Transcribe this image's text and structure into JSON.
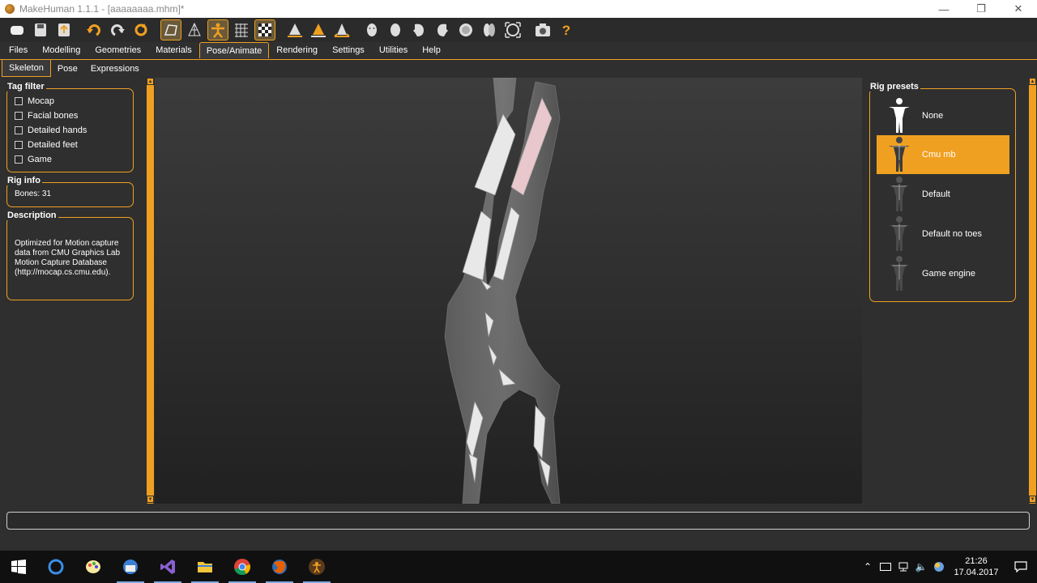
{
  "window": {
    "title": "MakeHuman 1.1.1 - [aaaaaaaa.mhm]*",
    "minimize_glyph": "—",
    "maximize_glyph": "❐",
    "close_glyph": "✕"
  },
  "toolbar": {
    "buttons": [
      {
        "icon": "new-icon"
      },
      {
        "icon": "save-icon"
      },
      {
        "icon": "export-icon"
      },
      {
        "icon": "undo-icon"
      },
      {
        "icon": "redo-icon"
      },
      {
        "icon": "reset-icon"
      },
      {
        "icon": "smooth-icon",
        "active": true
      },
      {
        "icon": "wireframe-icon"
      },
      {
        "icon": "pose-icon",
        "active": true
      },
      {
        "icon": "grid-icon"
      },
      {
        "icon": "checker-icon",
        "active": true
      },
      {
        "icon": "front-view-icon"
      },
      {
        "icon": "back-view-icon"
      },
      {
        "icon": "side-view-icon"
      },
      {
        "icon": "face-front-icon"
      },
      {
        "icon": "face-back-icon"
      },
      {
        "icon": "face-left-icon"
      },
      {
        "icon": "face-right-icon"
      },
      {
        "icon": "top-view-icon"
      },
      {
        "icon": "bottom-view-icon"
      },
      {
        "icon": "reset-camera-icon"
      },
      {
        "icon": "screenshot-icon"
      },
      {
        "icon": "help-icon"
      }
    ],
    "accent": "#f0a020"
  },
  "menu_tabs": [
    "Files",
    "Modelling",
    "Geometries",
    "Materials",
    "Pose/Animate",
    "Rendering",
    "Settings",
    "Utilities",
    "Help"
  ],
  "menu_active": "Pose/Animate",
  "sub_tabs": [
    "Skeleton",
    "Pose",
    "Expressions"
  ],
  "sub_active": "Skeleton",
  "tag_filter": {
    "title": "Tag filter",
    "items": [
      "Mocap",
      "Facial bones",
      "Detailed hands",
      "Detailed feet",
      "Game"
    ]
  },
  "rig_info": {
    "title": "Rig info",
    "bones": "Bones: 31"
  },
  "description": {
    "title": "Description",
    "text": "Optimized for Motion capture data from CMU Graphics Lab Motion Capture Database (http://mocap.cs.cmu.edu)."
  },
  "rig_presets": {
    "title": "Rig presets",
    "items": [
      "None",
      "Cmu mb",
      "Default",
      "Default no toes",
      "Game engine"
    ],
    "selected": "Cmu mb"
  },
  "taskbar": {
    "apps": [
      "windows-start-icon",
      "cortana-icon",
      "paint-icon",
      "thunderbird-icon",
      "visual-studio-icon",
      "file-explorer-icon",
      "chrome-icon",
      "firefox-icon",
      "makehuman-icon"
    ],
    "time": "21:26",
    "date": "17.04.2017"
  }
}
